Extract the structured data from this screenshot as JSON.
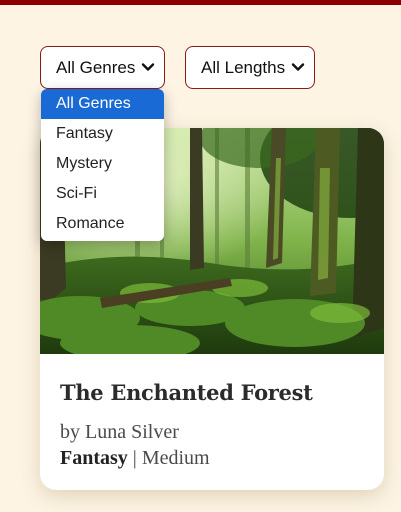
{
  "filters": {
    "genre": {
      "selected": "All Genres",
      "options": [
        "All Genres",
        "Fantasy",
        "Mystery",
        "Sci-Fi",
        "Romance"
      ]
    },
    "length": {
      "selected": "All Lengths"
    }
  },
  "book": {
    "title": "The Enchanted Forest",
    "author": "by Luna Silver",
    "genre": "Fantasy",
    "separator": "|",
    "length": "Medium"
  },
  "colors": {
    "accent": "#8b0000",
    "background": "#fdf4e4",
    "selected_option": "#1a6ad6"
  },
  "icons": {
    "dropdown": "chevron-down-icon"
  }
}
